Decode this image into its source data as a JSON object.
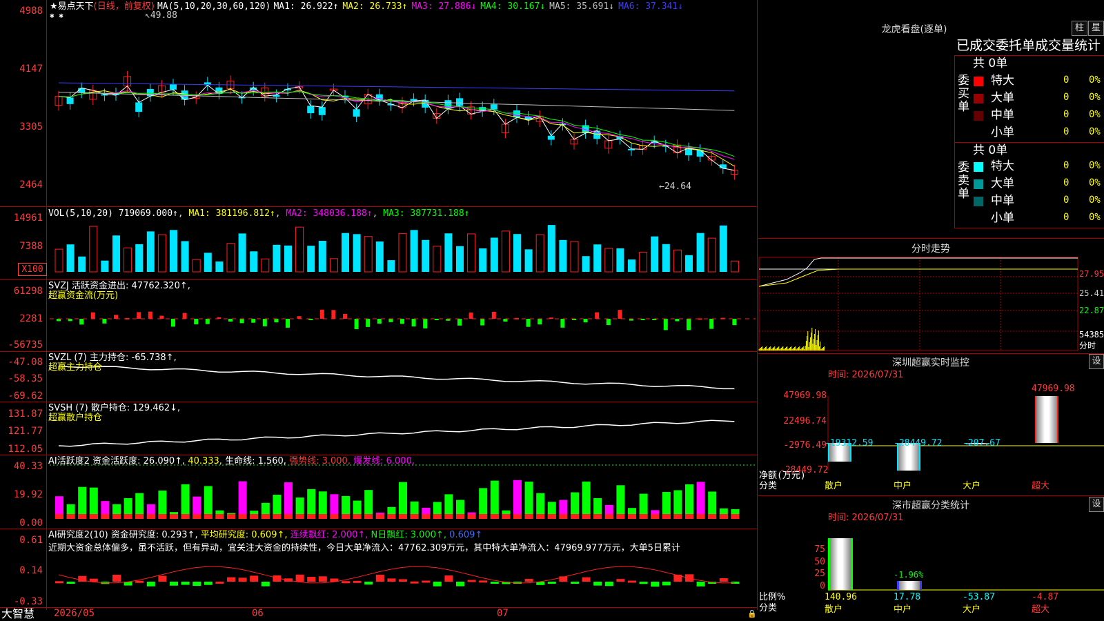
{
  "app": {
    "name": "大智慧"
  },
  "main_chart": {
    "star": "★",
    "stock_name": "易点天下",
    "period": "(日线，前复权)",
    "ma_label": "MA(5,10,20,30,60,120)",
    "ma": [
      {
        "label": "MA1: 26.922↑",
        "color": "#ffffff"
      },
      {
        "label": "MA2: 26.733↑",
        "color": "#ffff00"
      },
      {
        "label": "MA3: 27.886↓",
        "color": "#ff00ff"
      },
      {
        "label": "MA4: 30.167↓",
        "color": "#00ff00"
      },
      {
        "label": "MA5: 35.691↓",
        "color": "#c0c0c0"
      },
      {
        "label": "MA6: 37.341↓",
        "color": "#3b3bff"
      }
    ],
    "high_note": "49.88",
    "low_note": "←24.64",
    "y_ticks": [
      "4988",
      "4147",
      "3305",
      "2464"
    ],
    "x_labels": [
      "2026/05",
      "06",
      "07"
    ]
  },
  "vol_panel": {
    "label": "VOL(5,10,20)",
    "value": "719069.000↑",
    "ma1": "MA1: 381196.812↑",
    "ma2": "MA2: 348036.188↑",
    "ma3": "MA3: 387731.188↑",
    "y_ticks": [
      "14961",
      "7388"
    ],
    "unit_badge": "X100"
  },
  "svzj_panel": {
    "label": "SVZJ",
    "title": "活跃资金进出: 47762.320↑,",
    "subtitle": "超赢资金流(万元)",
    "y_ticks": [
      "61298",
      "2281",
      "-56735"
    ]
  },
  "svzl_panel": {
    "label": "SVZL (7)",
    "title": "主力持仓: -65.738↑,",
    "subtitle": "超赢主力持仓",
    "y_ticks": [
      "-47.08",
      "-58.35",
      "-69.62"
    ]
  },
  "svsh_panel": {
    "label": "SVSH (7)",
    "title": "散户持仓: 129.462↓,",
    "subtitle": "超赢散户持仓",
    "y_ticks": [
      "131.87",
      "121.77",
      "112.05"
    ]
  },
  "ai_active": {
    "label": "AI活跃度2",
    "text1": "资金活跃度: 26.090↑,",
    "text2": "40.333,",
    "text3": "生命线: 1.560,",
    "text4": "强势线: 3.000,",
    "text5": "爆发线: 6.000,",
    "y_ticks": [
      "40.33",
      "19.92",
      "0.00"
    ]
  },
  "ai_research": {
    "label": "AI研究度2(10)",
    "text1": "资金研究度: 0.293↑,",
    "text2": "平均研究度: 0.609↑,",
    "text3": "连续飘红: 2.000↑,",
    "text4": "N日飘红: 3.000↑,",
    "text5": "0.609↑",
    "comment": "近期大资金总体偏多，虽不活跃，但有异动，宜关注大资金的持续性，今日大单净流入：47762.309万元，其中特大单净流入：47969.977万元，大单5日累计",
    "y_ticks": [
      "0.61",
      "0.14",
      "-0.33"
    ]
  },
  "dragon_tiger": {
    "title": "龙虎看盘(逐单)",
    "btn_bar": "柱",
    "btn_grid": "星",
    "header": "已成交委托单成交量统计",
    "buy_side": {
      "label": "委买单",
      "total": "共 0单",
      "rows": [
        {
          "name": "特大",
          "count": "0",
          "pct": "0%",
          "color": "#ff0000"
        },
        {
          "name": "大单",
          "count": "0",
          "pct": "0%",
          "color": "#990000"
        },
        {
          "name": "中单",
          "count": "0",
          "pct": "0%",
          "color": "#660000"
        },
        {
          "name": "小单",
          "count": "0",
          "pct": "0%",
          "color": "#000000"
        }
      ]
    },
    "sell_side": {
      "label": "委卖单",
      "total": "共 0单",
      "rows": [
        {
          "name": "特大",
          "count": "0",
          "pct": "0%",
          "color": "#00ffff"
        },
        {
          "name": "大单",
          "count": "0",
          "pct": "0%",
          "color": "#009999"
        },
        {
          "name": "中单",
          "count": "0",
          "pct": "0%",
          "color": "#006666"
        },
        {
          "name": "小单",
          "count": "0",
          "pct": "0%",
          "color": "#000000"
        }
      ]
    }
  },
  "intraday": {
    "title": "分时走势",
    "y_ticks": [
      "27.95",
      "25.41",
      "22.87"
    ],
    "vol_tick": "54385",
    "vol_label": "分时"
  },
  "sz_monitor": {
    "title": "深圳超赢实时监控",
    "btn": "设",
    "time": "时间: 2026/07/31",
    "y_ticks": [
      "47969.98",
      "22496.74",
      "-2976.49",
      "-28449.72"
    ],
    "ylabel": "净额(万元)",
    "xlabel": "分类",
    "chart_data": {
      "type": "bar",
      "categories": [
        "散户",
        "中户",
        "大户",
        "超大"
      ],
      "values": [
        -19312.59,
        -28449.72,
        -207.67,
        47969.98
      ],
      "value_labels": [
        "-19312.59",
        "-28449.72",
        "-207.67",
        "47969.98"
      ],
      "ylim": [
        -28449.72,
        47969.98
      ]
    }
  },
  "sz_classify": {
    "title": "深市超赢分类统计",
    "btn": "设",
    "time": "时间: 2026/07/31",
    "y_ticks": [
      "75",
      "50",
      "25",
      "0"
    ],
    "ylabel": "比例%",
    "xlabel": "分类",
    "chart_data": {
      "type": "bar",
      "categories": [
        "散户",
        "中户",
        "大户",
        "超大"
      ],
      "values": [
        140.96,
        17.78,
        -53.87,
        -4.87
      ],
      "value_labels": [
        "140.96",
        "17.78",
        "-53.87",
        "-4.87"
      ],
      "extra_labels": [
        "",
        "-1.96%",
        "",
        ""
      ],
      "ylim": [
        0,
        100
      ]
    }
  }
}
